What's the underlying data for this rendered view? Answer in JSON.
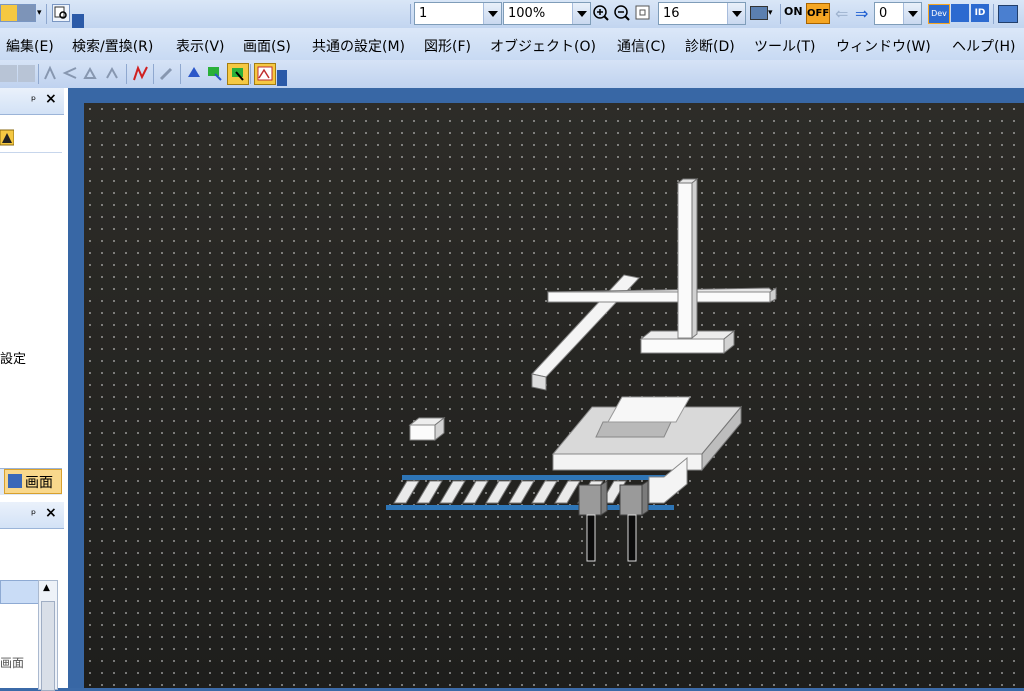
{
  "toolbar": {
    "station_value": "1",
    "zoom_value": "100%",
    "grid_value": "16",
    "on_label": "ON",
    "off_label": "OFF",
    "offset_value": "0",
    "dev_label": "Dev",
    "id_label": "ID"
  },
  "menu": [
    {
      "label": "編集(E)"
    },
    {
      "label": "検索/置換(R)"
    },
    {
      "label": "表示(V)"
    },
    {
      "label": "画面(S)"
    },
    {
      "label": "共通の設定(M)"
    },
    {
      "label": "図形(F)"
    },
    {
      "label": "オブジェクト(O)"
    },
    {
      "label": "通信(C)"
    },
    {
      "label": "診断(D)"
    },
    {
      "label": "ツール(T)"
    },
    {
      "label": "ウィンドウ(W)"
    },
    {
      "label": "ヘルプ(H)"
    }
  ],
  "left_panel": {
    "pin_label": "ᵖ",
    "close_label": "×",
    "settings_text": "設定",
    "screen_tab_label": "画面",
    "list_item_label": "画面"
  },
  "colors": {
    "accent": "#3b6aa8",
    "canvas_bg": "#2a2a26",
    "conveyor_blue": "#2e75b6"
  }
}
